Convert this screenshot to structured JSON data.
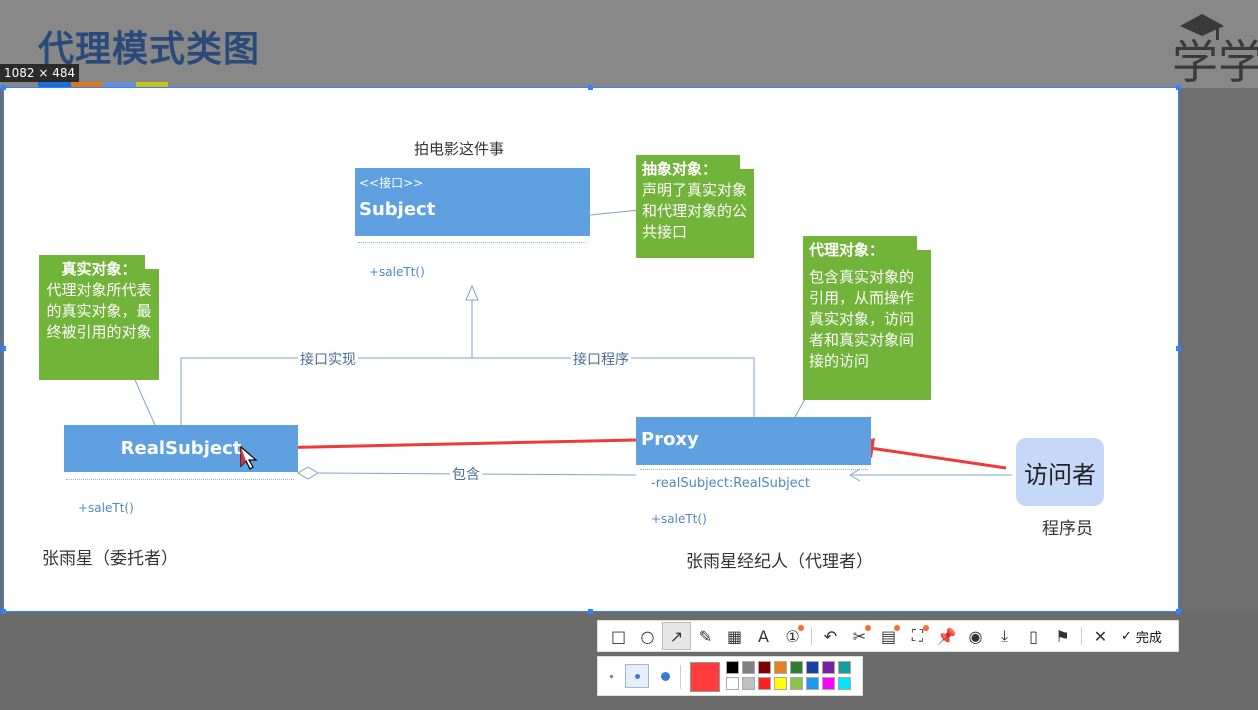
{
  "slide": {
    "title": "代理模式类图",
    "title_bar_colors": [
      "#1f6fd0",
      "#d97a1c",
      "#6a8ed0",
      "#c9c21c"
    ],
    "logo_text": "学学"
  },
  "screenshot_tool": {
    "size_label": "1082 × 484",
    "tools": [
      {
        "name": "rectangle-tool",
        "icon": "□",
        "active": false,
        "badge": false
      },
      {
        "name": "ellipse-tool",
        "icon": "○",
        "active": false,
        "badge": false
      },
      {
        "name": "arrow-tool",
        "icon": "↗",
        "active": true,
        "badge": false
      },
      {
        "name": "pencil-tool",
        "icon": "✎",
        "active": false,
        "badge": false
      },
      {
        "name": "mosaic-tool",
        "icon": "▦",
        "active": false,
        "badge": false
      },
      {
        "name": "text-tool",
        "icon": "A",
        "active": false,
        "badge": false
      },
      {
        "name": "number-tool",
        "icon": "①",
        "active": false,
        "badge": true
      },
      {
        "name": "undo-tool",
        "icon": "↶",
        "active": false,
        "badge": false
      },
      {
        "name": "scissor-tool",
        "icon": "✂",
        "active": false,
        "badge": true
      },
      {
        "name": "ocr-tool",
        "icon": "▤",
        "active": false,
        "badge": true
      },
      {
        "name": "scan-tool",
        "icon": "⛶",
        "active": false,
        "badge": true
      },
      {
        "name": "pin-tool",
        "icon": "📌",
        "active": false,
        "badge": false
      },
      {
        "name": "record-tool",
        "icon": "◉",
        "active": false,
        "badge": false
      },
      {
        "name": "download-tool",
        "icon": "⤓",
        "active": false,
        "badge": false
      },
      {
        "name": "phone-tool",
        "icon": "▯",
        "active": false,
        "badge": false
      },
      {
        "name": "bookmark-tool",
        "icon": "⚑",
        "active": false,
        "badge": false
      }
    ],
    "cancel_icon": "✕",
    "done_label": "完成",
    "selected_color": "#ff3b3b",
    "palette_top": [
      "#000000",
      "#808080",
      "#800000",
      "#e67e22",
      "#2e7d32",
      "#1a3fa6",
      "#7b1fa2",
      "#139c9c"
    ],
    "palette_bottom": [
      "#ffffff",
      "#c0c0c0",
      "#ff2020",
      "#ffff00",
      "#8bc34a",
      "#2196f3",
      "#ff00ff",
      "#00e5ff"
    ]
  },
  "diagram": {
    "top_caption": "拍电影这件事",
    "subject": {
      "stereotype": "<<接口>>",
      "name": "Subject",
      "method": "+saleTt()"
    },
    "realsubject": {
      "name": "RealSubject",
      "method": "+saleTt()",
      "caption": "张雨星（委托者）"
    },
    "proxy": {
      "name": "Proxy",
      "field": "-realSubject:RealSubject",
      "method": "+saleTt()",
      "caption": "张雨星经纪人（代理者）"
    },
    "visitor": {
      "label": "访问者",
      "caption": "程序员"
    },
    "connectors": {
      "implements_left": "接口实现",
      "implements_right": "接口程序",
      "contains": "包含"
    },
    "notes": {
      "abstract": {
        "title": "抽象对象：",
        "body": "声明了真实对象和代理对象的公共接口"
      },
      "real": {
        "title": "真实对象：",
        "body": "代理对象所代表的真实对象，最终被引用的对象"
      },
      "proxy": {
        "title": "代理对象：",
        "body": "包含真实对象的引用，从而操作真实对象，访问者和真实对象间接的访问"
      }
    }
  }
}
